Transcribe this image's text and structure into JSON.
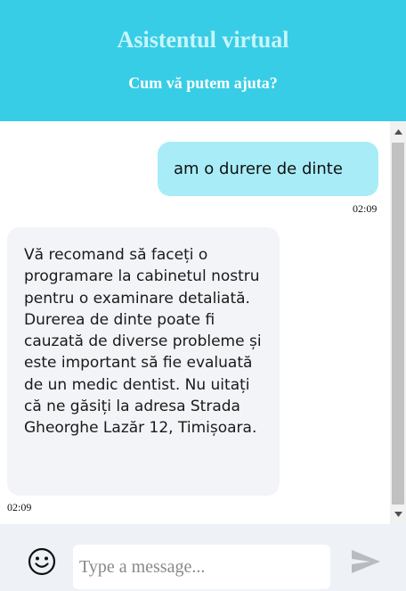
{
  "header": {
    "title": "Asistentul virtual",
    "subtitle": "Cum vă putem ajuta?"
  },
  "messages": [
    {
      "sender": "user",
      "text": "am o durere de dinte",
      "time": "02:09"
    },
    {
      "sender": "bot",
      "text": "Vă recomand să faceți o programare la cabinetul nostru pentru o examinare detaliată. Durerea de dinte poate fi cauzată de diverse probleme și este important să fie evaluată de un medic dentist. Nu uitați că ne găsiți la adresa Strada Gheorghe Lazăr 12, Timișoara.",
      "time": "02:09"
    }
  ],
  "composer": {
    "placeholder": "Type a message...",
    "value": "",
    "emoji_icon": "smiley-face-icon",
    "send_icon": "paper-plane-icon"
  },
  "colors": {
    "header_bg": "#38cde6",
    "user_bubble": "#a8ecf7",
    "bot_bubble": "#f2f4f7",
    "footer_bg": "#eef1f6"
  }
}
